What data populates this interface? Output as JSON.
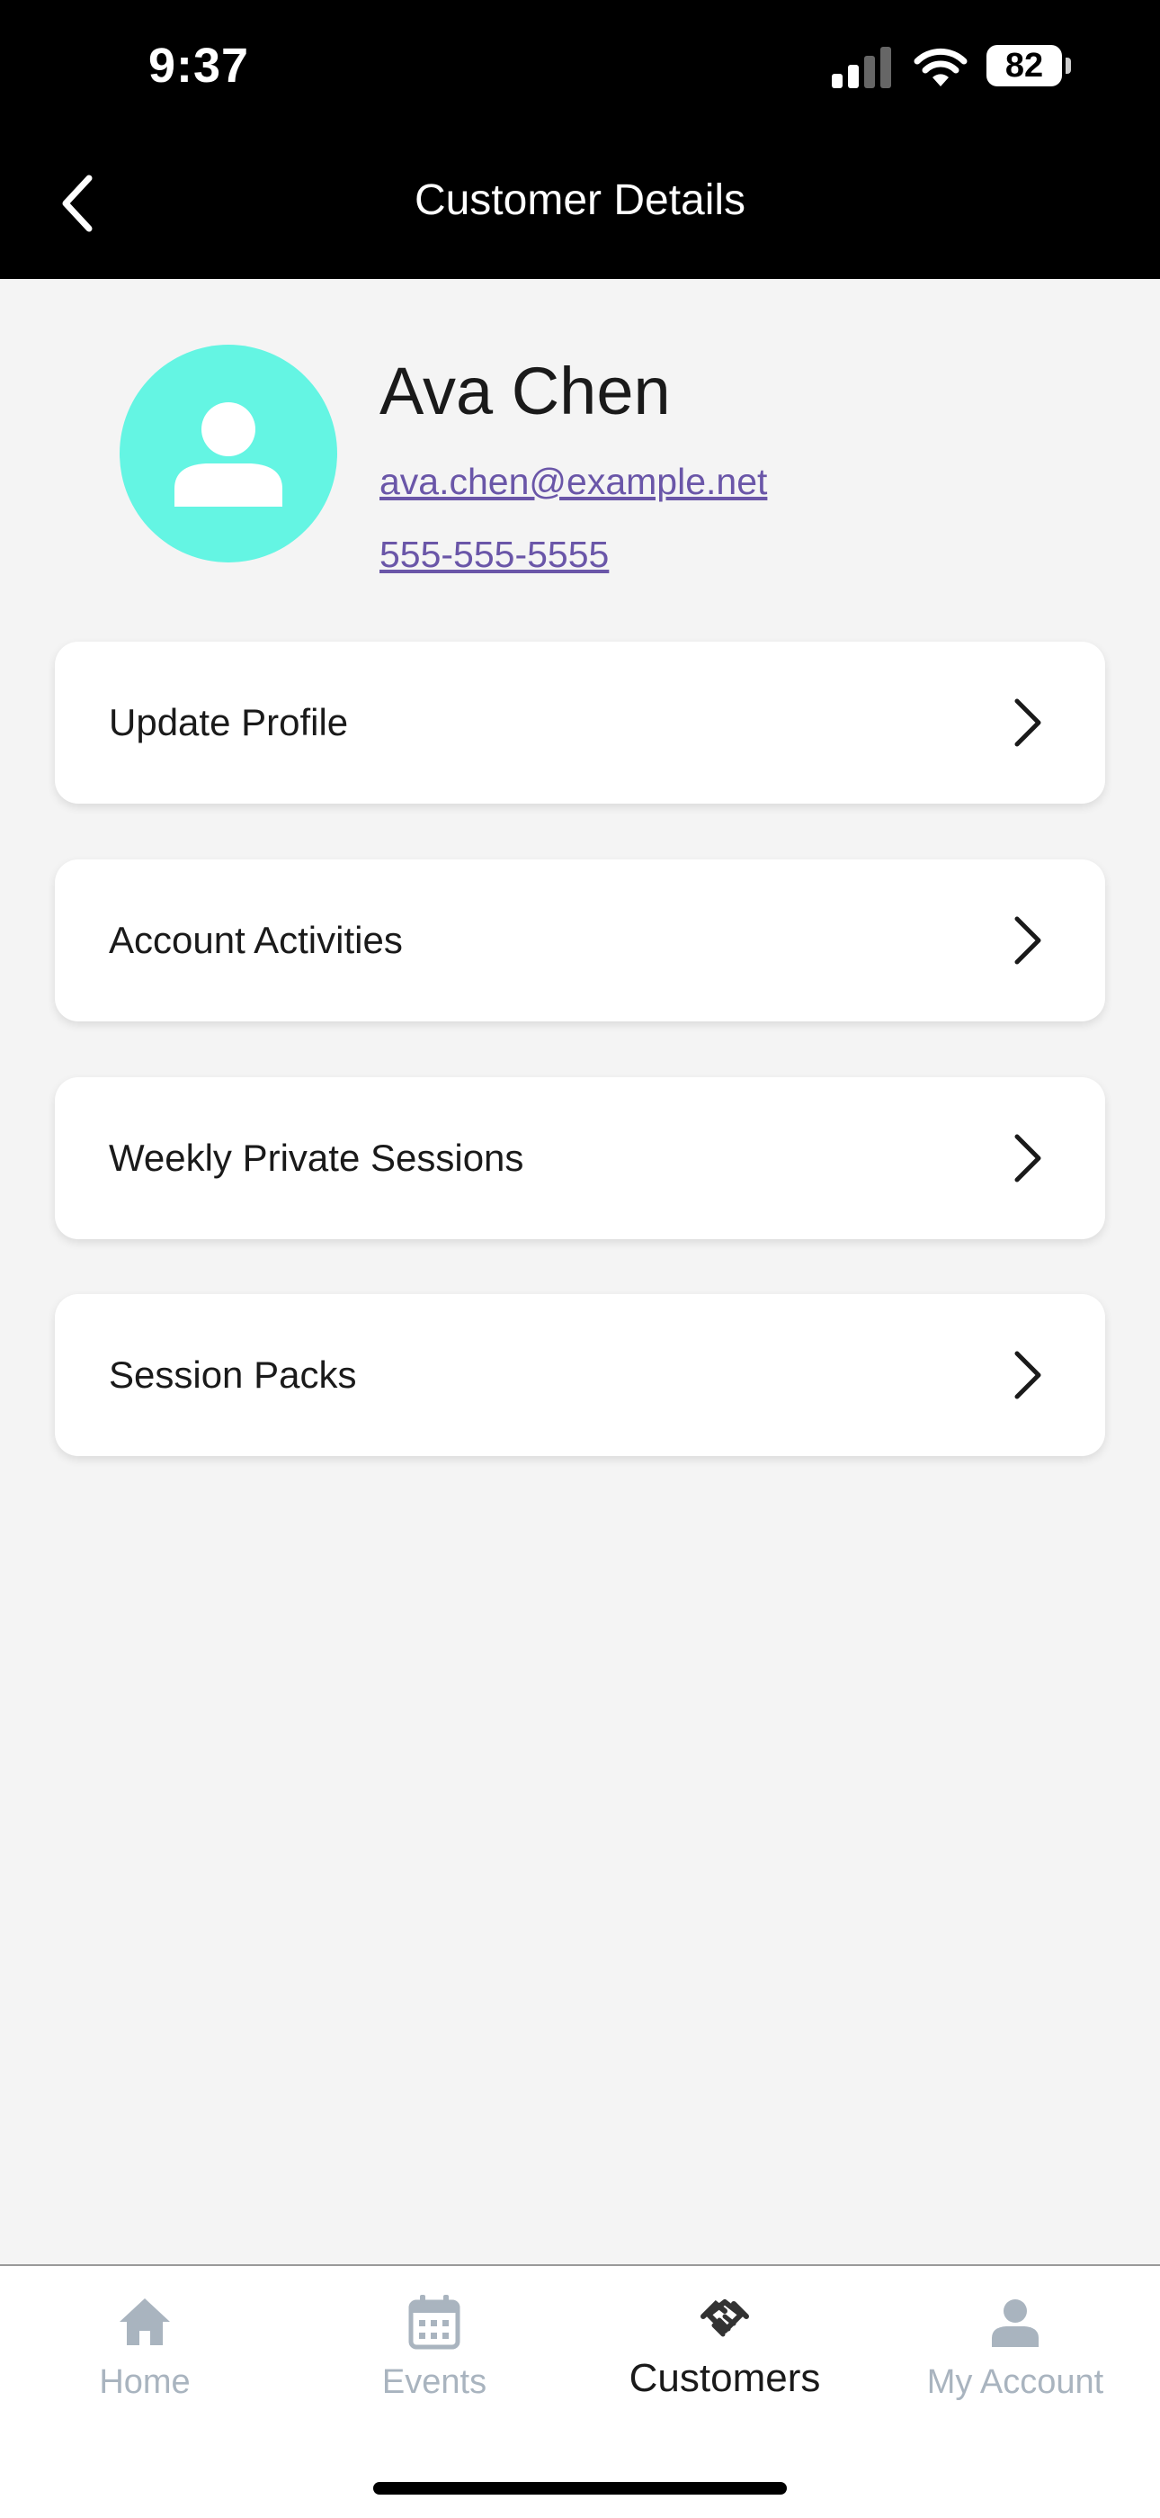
{
  "status_bar": {
    "time": "9:37",
    "battery": "82"
  },
  "header": {
    "title": "Customer Details",
    "back_icon": "chevron-left-icon"
  },
  "profile": {
    "name": "Ava Chen",
    "email": "ava.chen@example.net",
    "phone": "555-555-5555",
    "avatar_color": "#64f5e3"
  },
  "menu": [
    {
      "label": "Update Profile"
    },
    {
      "label": "Account Activities"
    },
    {
      "label": "Weekly Private Sessions"
    },
    {
      "label": "Session Packs"
    }
  ],
  "tabs": [
    {
      "label": "Home",
      "icon": "home-icon",
      "active": false
    },
    {
      "label": "Events",
      "icon": "calendar-icon",
      "active": false
    },
    {
      "label": "Customers",
      "icon": "handshake-icon",
      "active": true
    },
    {
      "label": "My Account",
      "icon": "person-icon",
      "active": false
    }
  ],
  "colors": {
    "header_bg": "#000000",
    "link": "#6a56a8",
    "inactive_tab": "#a9b4bf"
  }
}
